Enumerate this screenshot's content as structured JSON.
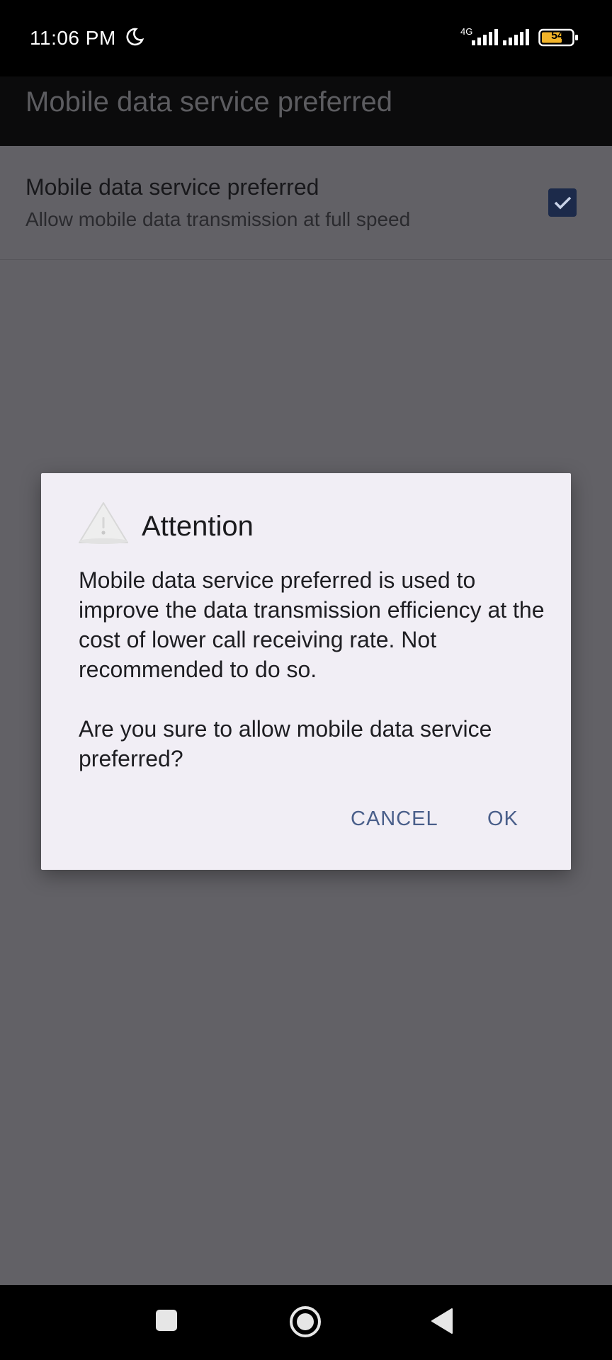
{
  "status_bar": {
    "time": "11:06 PM",
    "network_type": "4G",
    "battery_level": "54",
    "icons": [
      "moon-icon",
      "signal-4g-icon",
      "signal-icon",
      "battery-icon"
    ]
  },
  "app_bar": {
    "title": "Mobile data service preferred"
  },
  "preference": {
    "title": "Mobile data service preferred",
    "summary": "Allow mobile data transmission at full speed",
    "checked": true
  },
  "dialog": {
    "title": "Attention",
    "icon": "warning-icon",
    "body": "Mobile data service preferred is used to improve the data transmission efficiency at the cost of lower call receiving rate. Not recommended to do so.\n\nAre you sure to allow mobile data service preferred?",
    "cancel_label": "CANCEL",
    "ok_label": "OK"
  },
  "nav_bar": {
    "icons": [
      "recents-icon",
      "home-icon",
      "back-icon"
    ]
  },
  "colors": {
    "scrim_background": "#626166",
    "dialog_background": "#f1eef5",
    "button_text": "#4a5f8a",
    "checkbox": "#1c2a4a"
  }
}
